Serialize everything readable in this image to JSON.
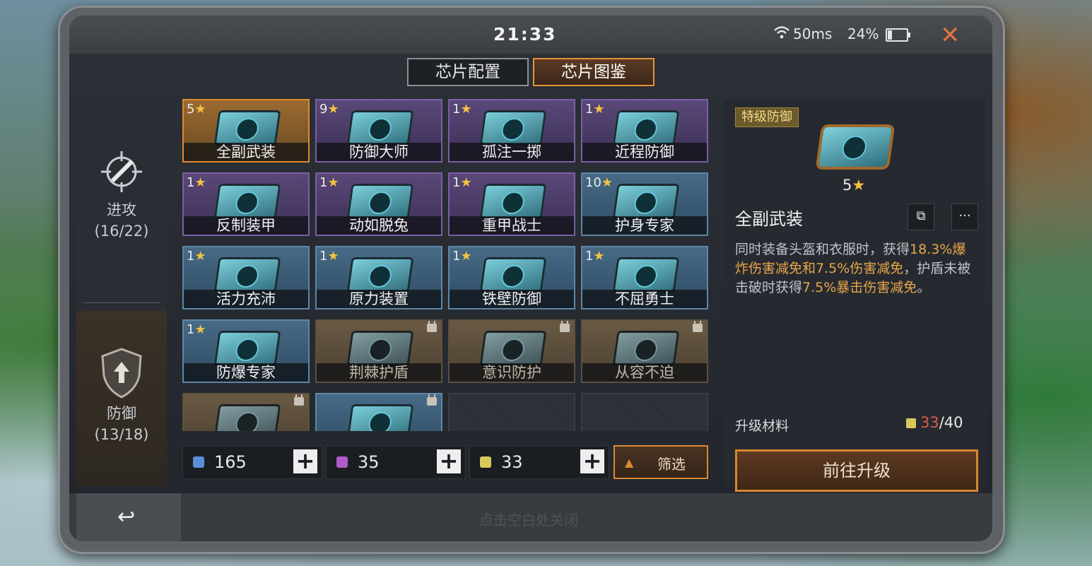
{
  "status": {
    "time": "21:33",
    "ping": "50ms",
    "battery": "24%",
    "battery_level": 0.24
  },
  "tabs": [
    {
      "label": "芯片配置",
      "active": false
    },
    {
      "label": "芯片图鉴",
      "active": true
    }
  ],
  "sidebar": {
    "attack": {
      "label": "进攻",
      "count": "(16/22)"
    },
    "defense": {
      "label": "防御",
      "count": "(13/18)"
    }
  },
  "chips": [
    {
      "stars": "5",
      "name": "全副武装",
      "style": "gold",
      "locked": false
    },
    {
      "stars": "9",
      "name": "防御大师",
      "style": "purple",
      "locked": false
    },
    {
      "stars": "1",
      "name": "孤注一掷",
      "style": "purple",
      "locked": false
    },
    {
      "stars": "1",
      "name": "近程防御",
      "style": "purple",
      "locked": false
    },
    {
      "stars": "1",
      "name": "反制装甲",
      "style": "purple",
      "locked": false
    },
    {
      "stars": "1",
      "name": "动如脱兔",
      "style": "purple",
      "locked": false
    },
    {
      "stars": "1",
      "name": "重甲战士",
      "style": "purple",
      "locked": false
    },
    {
      "stars": "10",
      "name": "护身专家",
      "style": "blue",
      "locked": false
    },
    {
      "stars": "1",
      "name": "活力充沛",
      "style": "blue",
      "locked": false
    },
    {
      "stars": "1",
      "name": "原力装置",
      "style": "blue",
      "locked": false
    },
    {
      "stars": "1",
      "name": "铁壁防御",
      "style": "blue",
      "locked": false
    },
    {
      "stars": "1",
      "name": "不屈勇士",
      "style": "blue",
      "locked": false
    },
    {
      "stars": "1",
      "name": "防爆专家",
      "style": "blue",
      "locked": false
    },
    {
      "stars": "",
      "name": "荆棘护盾",
      "style": "locked",
      "locked": true
    },
    {
      "stars": "",
      "name": "意识防护",
      "style": "locked",
      "locked": true
    },
    {
      "stars": "",
      "name": "从容不迫",
      "style": "locked",
      "locked": true
    },
    {
      "stars": "",
      "name": "",
      "style": "locked",
      "locked": true
    },
    {
      "stars": "",
      "name": "",
      "style": "blue",
      "locked": true
    },
    {
      "stars": "",
      "name": "",
      "style": "empty",
      "locked": false
    },
    {
      "stars": "",
      "name": "",
      "style": "empty",
      "locked": false
    }
  ],
  "resources": [
    {
      "value": "165",
      "color": "#5a8fd8"
    },
    {
      "value": "35",
      "color": "#b05ac8"
    },
    {
      "value": "33",
      "color": "#d8c95a"
    }
  ],
  "filter_label": "筛选",
  "detail": {
    "tier": "特级防御",
    "stars": "5",
    "title": "全副武装",
    "desc_parts": [
      {
        "text": "同时装备头盔和衣服时，获得",
        "hl": false
      },
      {
        "text": "18.3%爆炸伤害减免和7.5%伤害",
        "hl": true
      },
      {
        "text": "减免",
        "hl": true
      },
      {
        "text": "，护盾未被击破时获得",
        "hl": false
      },
      {
        "text": "7.5%",
        "hl": true
      },
      {
        "text": "暴击伤害减免",
        "hl": true
      },
      {
        "text": "。",
        "hl": false
      }
    ],
    "upgrade_label": "升级材料",
    "upgrade_current": "33",
    "upgrade_total": "/40",
    "go_upgrade": "前往升级"
  },
  "bottom": {
    "close_hint": "点击空白处关闭"
  },
  "colors": {
    "accent": "#e6923d",
    "star": "#f4c241",
    "highlight": "#e9a64a"
  }
}
